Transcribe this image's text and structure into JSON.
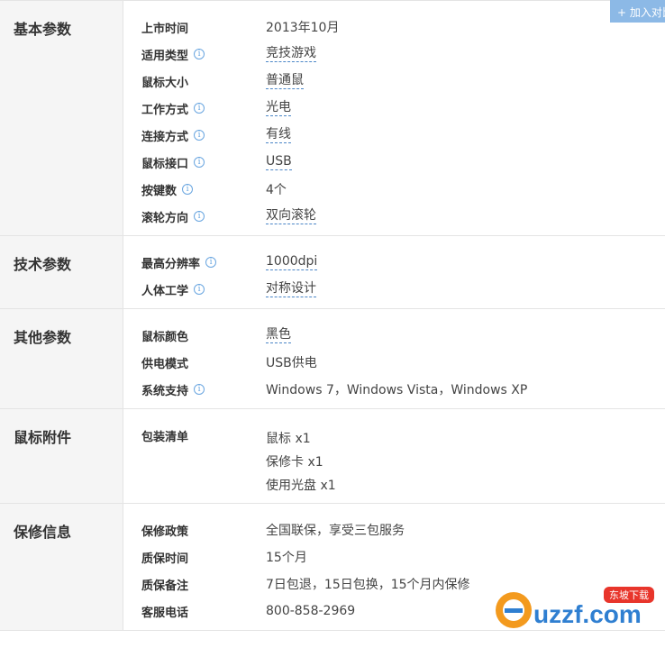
{
  "compare_label": "+ 加入对比",
  "sections": [
    {
      "title": "基本参数",
      "rows": [
        {
          "label": "上市时间",
          "info": false,
          "value": "2013年10月",
          "link": false
        },
        {
          "label": "适用类型",
          "info": true,
          "value": "竞技游戏",
          "link": true
        },
        {
          "label": "鼠标大小",
          "info": false,
          "value": "普通鼠",
          "link": true
        },
        {
          "label": "工作方式",
          "info": true,
          "value": "光电",
          "link": true
        },
        {
          "label": "连接方式",
          "info": true,
          "value": "有线",
          "link": true
        },
        {
          "label": "鼠标接口",
          "info": true,
          "value": "USB",
          "link": true
        },
        {
          "label": "按键数",
          "info": true,
          "value": "4个",
          "link": false
        },
        {
          "label": "滚轮方向",
          "info": true,
          "value": "双向滚轮",
          "link": true
        }
      ]
    },
    {
      "title": "技术参数",
      "rows": [
        {
          "label": "最高分辨率",
          "info": true,
          "value": "1000dpi",
          "link": true
        },
        {
          "label": "人体工学",
          "info": true,
          "value": "对称设计",
          "link": true
        }
      ]
    },
    {
      "title": "其他参数",
      "rows": [
        {
          "label": "鼠标颜色",
          "info": false,
          "value": "黑色",
          "link": true
        },
        {
          "label": "供电模式",
          "info": false,
          "value": "USB供电",
          "link": false
        },
        {
          "label": "系统支持",
          "info": true,
          "value": "Windows 7，Windows Vista，Windows XP",
          "link": false
        }
      ]
    },
    {
      "title": "鼠标附件",
      "rows": [
        {
          "label": "包装清单",
          "info": false,
          "values": [
            "鼠标 x1",
            "保修卡 x1",
            "使用光盘 x1"
          ]
        }
      ]
    },
    {
      "title": "保修信息",
      "rows": [
        {
          "label": "保修政策",
          "info": false,
          "value": "全国联保，享受三包服务",
          "link": false
        },
        {
          "label": "质保时间",
          "info": false,
          "value": "15个月",
          "link": false
        },
        {
          "label": "质保备注",
          "info": false,
          "value": "7日包退，15日包换，15个月内保修",
          "link": false
        },
        {
          "label": "客服电话",
          "info": false,
          "value": "800-858-2969",
          "link": false
        }
      ]
    }
  ],
  "watermark": {
    "brand": "uzzf.com",
    "tag": "东坡下载"
  },
  "colors": {
    "accent": "#4b86c7",
    "button": "#8cb9e6",
    "title_bg": "#f5f5f5",
    "border": "#e4e4e4"
  }
}
